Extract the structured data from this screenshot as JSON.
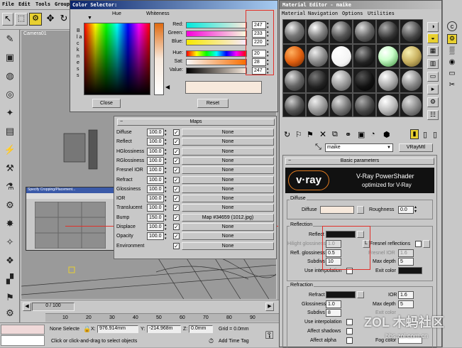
{
  "max": {
    "menu": [
      "File",
      "Edit",
      "Tools",
      "Group"
    ],
    "viewport_label": "Camera01",
    "timeline": {
      "position": "0 / 100",
      "ticks": [
        "10",
        "20",
        "30",
        "40",
        "50",
        "60",
        "70",
        "80",
        "90"
      ]
    },
    "status": {
      "selection": "None Selecte",
      "x_label": "X:",
      "x": "976.914mm",
      "y_label": "Y:",
      "y": "-214.968m",
      "z_label": "Z:",
      "z": "0.0mm",
      "grid": "Grid = 0.0mm",
      "prompt": "Click or click-and-drag to select objects",
      "add_time_tag": "Add Time Tag",
      "mini_window_title": "Specify Cropping/Placement..."
    }
  },
  "color_selector": {
    "title": "Color Selector:",
    "hue_header": "Hue",
    "whiteness_header": "Whiteness",
    "blackness_label": "B l a c k n e s s",
    "rows": [
      {
        "label": "Red:",
        "value": "247"
      },
      {
        "label": "Green:",
        "value": "233"
      },
      {
        "label": "Blue:",
        "value": "220"
      },
      {
        "label": "Hue:",
        "value": "20"
      },
      {
        "label": "Sat:",
        "value": "28"
      },
      {
        "label": "Value:",
        "value": "247"
      }
    ],
    "close_label": "Close",
    "reset_label": "Reset",
    "current_color": "#f7e9dc"
  },
  "maps_panel": {
    "title": "Maps",
    "rows": [
      {
        "name": "Diffuse",
        "amount": "100.0",
        "map": "None"
      },
      {
        "name": "Reflect",
        "amount": "100.0",
        "map": "None"
      },
      {
        "name": "HGlossiness",
        "amount": "100.0",
        "map": "None"
      },
      {
        "name": "RGlossiness",
        "amount": "100.0",
        "map": "None"
      },
      {
        "name": "Fresnel IOR",
        "amount": "100.0",
        "map": "None"
      },
      {
        "name": "Refract",
        "amount": "100.0",
        "map": "None"
      },
      {
        "name": "Glossiness",
        "amount": "100.0",
        "map": "None"
      },
      {
        "name": "IOR",
        "amount": "100.0",
        "map": "None"
      },
      {
        "name": "Translucent",
        "amount": "100.0",
        "map": "None"
      },
      {
        "name": "Bump",
        "amount": "150.0",
        "map": "Map #34659 (1012.jpg)"
      },
      {
        "name": "Displace",
        "amount": "100.0",
        "map": "None"
      },
      {
        "name": "Opacity",
        "amount": "100.0",
        "map": "None"
      },
      {
        "name": "Environment",
        "amount": "",
        "map": "None"
      }
    ]
  },
  "material_editor": {
    "title": "Material Editor - maike",
    "menu": [
      "Material",
      "Navigation",
      "Options",
      "Utilities"
    ],
    "material_name": "maike",
    "material_type": "VRayMtl",
    "rollout_title": "Basic parameters",
    "logo": {
      "brand": "v·ray",
      "title": "V-Ray PowerShader",
      "subtitle": "optimized for V-Ray"
    },
    "diffuse": {
      "group": "Diffuse",
      "label": "Diffuse",
      "roughness_label": "Roughness",
      "roughness": "0.0"
    },
    "reflection": {
      "group": "Reflection",
      "reflect_label": "Reflect",
      "hilight_label": "Hilight glossiness",
      "hilight": "1.0",
      "l_button": "L",
      "refl_gloss_label": "Refl. glossiness",
      "refl_gloss": "0.5",
      "subdivs_label": "Subdivs",
      "subdivs": "10",
      "interp_label": "Use interpolation",
      "fresnel_label": "Fresnel reflections",
      "fresnel_ior_label": "Fresnel IOR",
      "fresnel_ior": "1.6",
      "max_depth_label": "Max depth",
      "max_depth": "5",
      "exit_label": "Exit color"
    },
    "refraction": {
      "group": "Refraction",
      "refract_label": "Refract",
      "gloss_label": "Glossiness",
      "gloss": "1.0",
      "subdivs_label": "Subdivs",
      "subdivs": "8",
      "interp_label": "Use interpolation",
      "shadows_label": "Affect shadows",
      "alpha_label": "Affect alpha",
      "ior_label": "IOR",
      "ior": "1.6",
      "max_depth_label": "Max depth",
      "max_depth": "5",
      "exit_label": "Exit color",
      "fog_label": "Fog color",
      "fog_bias_label": "Fog bias"
    }
  },
  "watermark": {
    "text": "ZOL 木蚂社区",
    "url": "bbs.zol.com.cn"
  },
  "colors": {
    "highlight_box": "#e0302a",
    "swatch_black": "#141414",
    "diffuse_swatch": "#f7e9dc"
  }
}
